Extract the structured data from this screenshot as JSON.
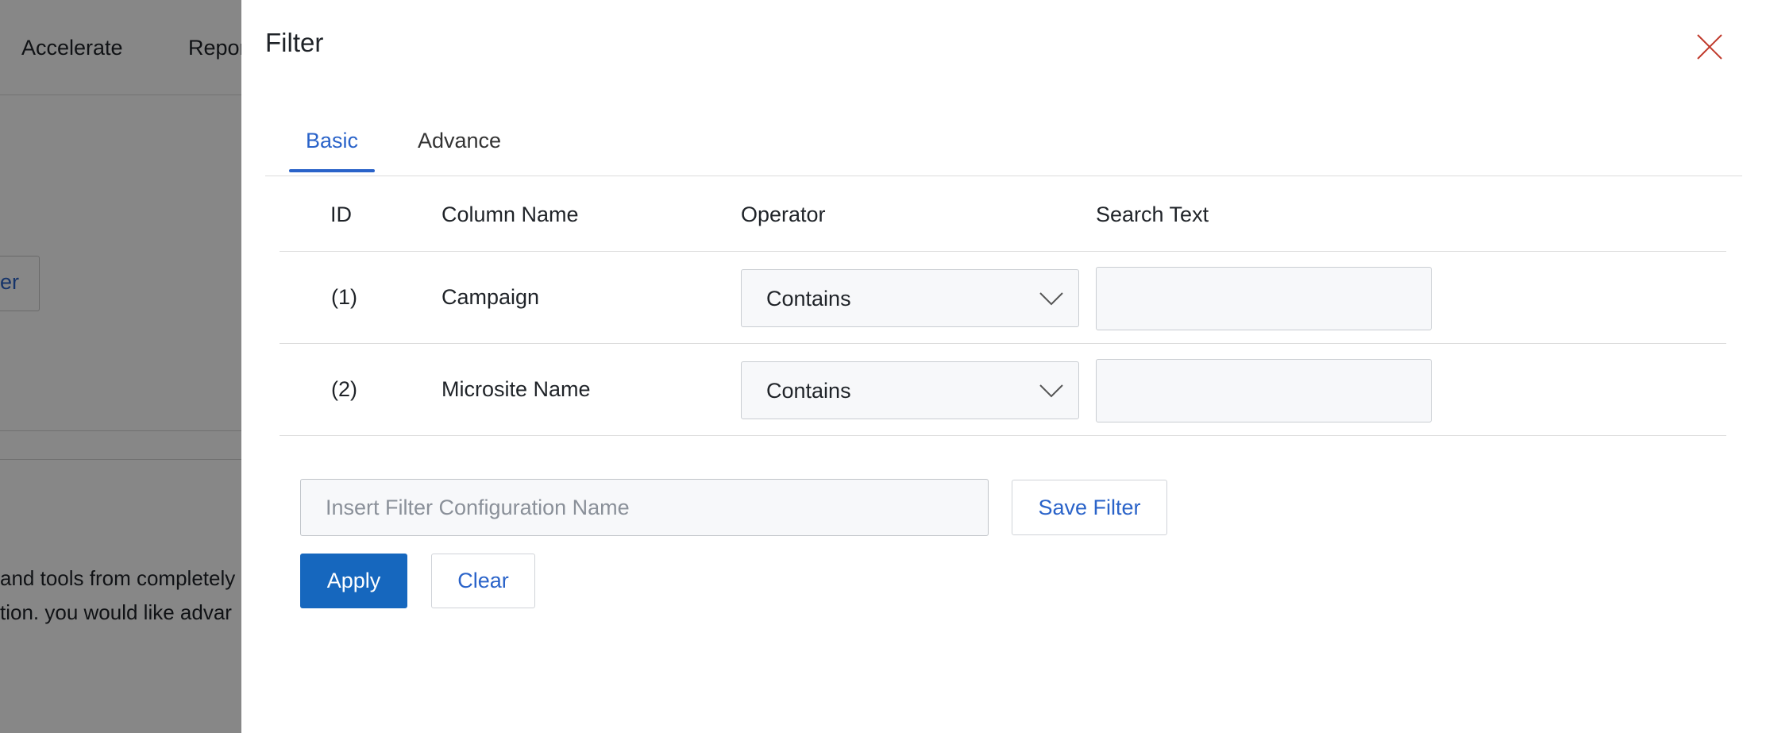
{
  "background": {
    "nav": {
      "accelerate": "Accelerate",
      "reports": "Repor"
    },
    "button_label": "er",
    "text_line_1": "and tools from completely",
    "text_line_2": "tion. you would like advar"
  },
  "drawer": {
    "title": "Filter",
    "close_icon": "close-icon",
    "tabs": [
      {
        "label": "Basic",
        "active": true
      },
      {
        "label": "Advance",
        "active": false
      }
    ],
    "table": {
      "headers": {
        "id": "ID",
        "column_name": "Column Name",
        "operator": "Operator",
        "search_text": "Search Text"
      },
      "rows": [
        {
          "id": "(1)",
          "column_name": "Campaign",
          "operator": "Contains",
          "search_text": ""
        },
        {
          "id": "(2)",
          "column_name": "Microsite Name",
          "operator": "Contains",
          "search_text": ""
        }
      ]
    },
    "config_name_placeholder": "Insert Filter Configuration Name",
    "save_filter_label": "Save Filter",
    "apply_label": "Apply",
    "clear_label": "Clear"
  },
  "colors": {
    "accent": "#2a63c9",
    "primary_button": "#1667be",
    "close_icon": "#c0392b",
    "overlay": "rgba(0,0,0,0.47)"
  }
}
